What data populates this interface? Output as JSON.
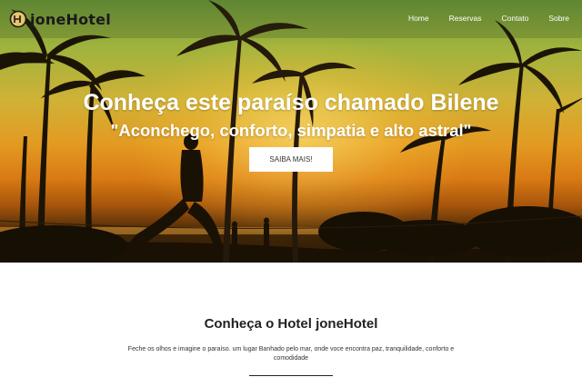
{
  "brand": {
    "name": "joneHotel",
    "icon": "hotel-logo-icon"
  },
  "nav": {
    "items": [
      {
        "label": "Home"
      },
      {
        "label": "Reservas"
      },
      {
        "label": "Contato"
      },
      {
        "label": "Sobre"
      }
    ]
  },
  "hero": {
    "title": "Conheça este paraíso chamado Bilene",
    "subtitle": "\"Aconchego, conforto, simpatia e alto astral\"",
    "cta_label": "SAIBA MAIS!"
  },
  "about": {
    "title": "Conheça o Hotel joneHotel",
    "text": "Feche os olhos e imagine o paraíso. um lugar Banhado pelo mar, onde voce encontra paz, tranquilidade, conforto e comodidade"
  },
  "colors": {
    "hero_sky_top": "#6b9a3a",
    "hero_sunset": "#e39a22",
    "hero_shadow": "#1d1205",
    "cta_bg": "#ffffff",
    "text_dark": "#222222"
  }
}
